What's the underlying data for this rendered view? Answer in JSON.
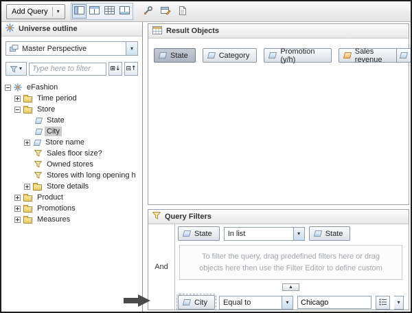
{
  "toolbar": {
    "add_query_label": "Add Query",
    "view_buttons": [
      "outline-view",
      "result-view",
      "data-view",
      "layout-view"
    ],
    "tool_buttons": [
      "wrench",
      "window-edit",
      "document"
    ]
  },
  "glyphs": {
    "caret_down": "▾",
    "collapse_up": "▲",
    "expand_all": "⊞↓",
    "collapse_all": "⊟↑"
  },
  "left_panel": {
    "title": "Universe outline",
    "perspective_selected": "Master Perspective",
    "filter_placeholder": "Type here to filter",
    "tree": [
      {
        "label": "eFashion",
        "icon": "universe",
        "state": "expanded"
      },
      {
        "label": "Time period",
        "icon": "folder",
        "state": "collapsed"
      },
      {
        "label": "Store",
        "icon": "folder",
        "state": "expanded"
      },
      {
        "label": "State",
        "icon": "dimension"
      },
      {
        "label": "City",
        "icon": "dimension",
        "selected": true
      },
      {
        "label": "Store name",
        "icon": "dimension",
        "state": "collapsed"
      },
      {
        "label": "Sales floor size?",
        "icon": "filter"
      },
      {
        "label": "Owned stores",
        "icon": "filter"
      },
      {
        "label": "Stores with long opening h",
        "icon": "filter"
      },
      {
        "label": "Store details",
        "icon": "folder",
        "state": "collapsed"
      },
      {
        "label": "Product",
        "icon": "folder",
        "state": "collapsed"
      },
      {
        "label": "Promotions",
        "icon": "folder",
        "state": "collapsed"
      },
      {
        "label": "Measures",
        "icon": "folder",
        "state": "collapsed"
      }
    ]
  },
  "result_objects": {
    "title": "Result Objects",
    "pills": [
      {
        "label": "State",
        "type": "dimension",
        "selected": true
      },
      {
        "label": "Category",
        "type": "dimension",
        "selected": false
      },
      {
        "label": "Promotion (y/h)",
        "type": "dimension",
        "selected": false
      },
      {
        "label": "Sales revenue",
        "type": "measure",
        "selected": false
      },
      {
        "label": "",
        "type": "dimension",
        "clipped": true
      }
    ]
  },
  "query_filters": {
    "title": "Query Filters",
    "operator_label": "And",
    "row_top": {
      "object": "State",
      "operator": "In list",
      "value_object": "State"
    },
    "hint_text": "To filter the query, drag predefined filters here or drag objects here then use the Filter Editor to define custom",
    "row_bottom": {
      "object": "City",
      "operator": "Equal to",
      "value": "Chicago"
    }
  },
  "colors": {
    "selected_pill": "#b0b8c4",
    "tree_highlight": "#cbcbcb",
    "hint_text": "#a2a6ac",
    "annotation_arrow": "#4a4a4a"
  }
}
